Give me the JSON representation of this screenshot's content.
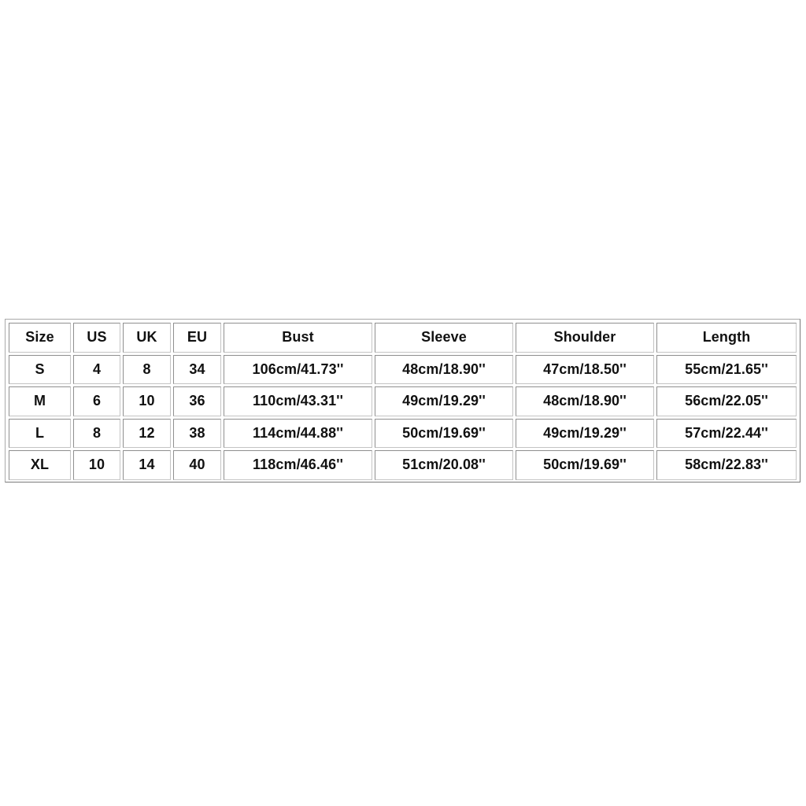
{
  "size_chart": {
    "headers": [
      "Size",
      "US",
      "UK",
      "EU",
      "Bust",
      "Sleeve",
      "Shoulder",
      "Length"
    ],
    "rows": [
      [
        "S",
        "4",
        "8",
        "34",
        "106cm/41.73''",
        "48cm/18.90''",
        "47cm/18.50''",
        "55cm/21.65''"
      ],
      [
        "M",
        "6",
        "10",
        "36",
        "110cm/43.31''",
        "49cm/19.29''",
        "48cm/18.90''",
        "56cm/22.05''"
      ],
      [
        "L",
        "8",
        "12",
        "38",
        "114cm/44.88''",
        "50cm/19.69''",
        "49cm/19.29''",
        "57cm/22.44''"
      ],
      [
        "XL",
        "10",
        "14",
        "40",
        "118cm/46.46''",
        "51cm/20.08''",
        "50cm/19.69''",
        "58cm/22.83''"
      ]
    ]
  }
}
